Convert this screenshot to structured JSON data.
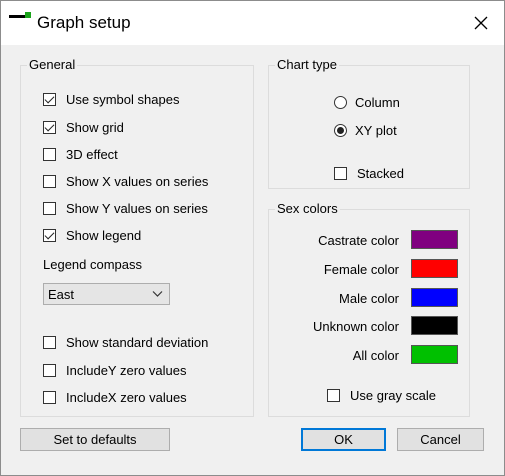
{
  "window": {
    "title": "Graph setup"
  },
  "general": {
    "label": "General",
    "options": [
      {
        "label": "Use symbol shapes",
        "checked": true
      },
      {
        "label": "Show grid",
        "checked": true
      },
      {
        "label": "3D effect",
        "checked": false
      },
      {
        "label": "Show X values on series",
        "checked": false
      },
      {
        "label": "Show Y values on series",
        "checked": false
      },
      {
        "label": "Show legend",
        "checked": true
      }
    ],
    "legend_compass_label": "Legend compass",
    "legend_compass_value": "East",
    "extra_options": [
      {
        "label": "Show standard deviation",
        "checked": false
      },
      {
        "label": "IncludeY zero values",
        "checked": false
      },
      {
        "label": "IncludeX zero values",
        "checked": false
      }
    ]
  },
  "chart_type": {
    "label": "Chart type",
    "options": [
      {
        "label": "Column",
        "selected": false
      },
      {
        "label": "XY plot",
        "selected": true
      }
    ],
    "stacked_label": "Stacked",
    "stacked_checked": false
  },
  "sex_colors": {
    "label": "Sex colors",
    "items": [
      {
        "label": "Castrate color",
        "color": "#800080"
      },
      {
        "label": "Female color",
        "color": "#ff0000"
      },
      {
        "label": "Male color",
        "color": "#0000ff"
      },
      {
        "label": "Unknown color",
        "color": "#000000"
      },
      {
        "label": "All color",
        "color": "#00c000"
      }
    ],
    "gray_scale_label": "Use gray scale",
    "gray_scale_checked": false
  },
  "buttons": {
    "set_defaults": "Set to defaults",
    "ok": "OK",
    "cancel": "Cancel"
  }
}
